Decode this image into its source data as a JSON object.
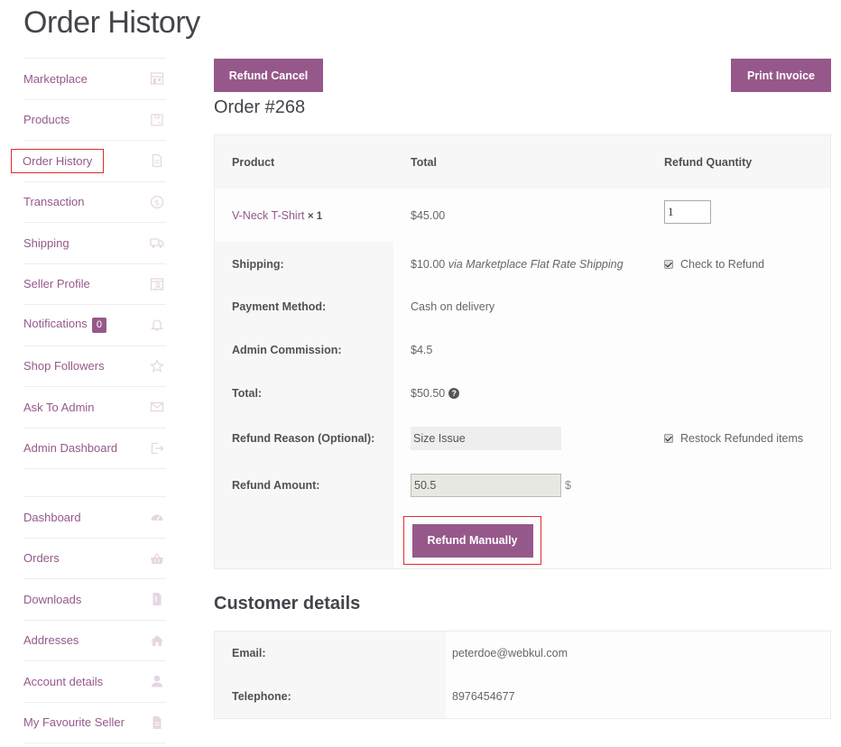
{
  "page": {
    "title": "Order History"
  },
  "sidebar": {
    "primary": [
      {
        "label": "Marketplace",
        "icon": "store-icon"
      },
      {
        "label": "Products",
        "icon": "box-icon"
      },
      {
        "label": "Order History",
        "icon": "document-icon",
        "active": true
      },
      {
        "label": "Transaction",
        "icon": "dollar-circle-icon"
      },
      {
        "label": "Shipping",
        "icon": "truck-icon"
      },
      {
        "label": "Seller Profile",
        "icon": "profile-card-icon"
      },
      {
        "label": "Notifications",
        "icon": "bell-icon",
        "badge": "0"
      },
      {
        "label": "Shop Followers",
        "icon": "star-icon"
      },
      {
        "label": "Ask To Admin",
        "icon": "envelope-icon"
      },
      {
        "label": "Admin Dashboard",
        "icon": "sign-out-icon"
      }
    ],
    "secondary": [
      {
        "label": "Dashboard",
        "icon": "speedometer-icon"
      },
      {
        "label": "Orders",
        "icon": "basket-icon"
      },
      {
        "label": "Downloads",
        "icon": "file-download-icon"
      },
      {
        "label": "Addresses",
        "icon": "home-icon"
      },
      {
        "label": "Account details",
        "icon": "user-icon"
      },
      {
        "label": "My Favourite Seller",
        "icon": "file-icon"
      }
    ]
  },
  "actions": {
    "refund_cancel": "Refund Cancel",
    "print_invoice": "Print Invoice"
  },
  "order": {
    "title": "Order #268",
    "headers": {
      "product": "Product",
      "total": "Total",
      "refund_qty": "Refund Quantity"
    },
    "item": {
      "name": "V-Neck T-Shirt",
      "qty": "× 1",
      "total": "$45.00",
      "refund_qty_value": "1"
    },
    "shipping": {
      "label": "Shipping:",
      "amount": "$10.00",
      "method": "via Marketplace Flat Rate Shipping",
      "checkbox_label": "Check to Refund",
      "checked": true
    },
    "payment_method": {
      "label": "Payment Method:",
      "value": "Cash on delivery"
    },
    "admin_commission": {
      "label": "Admin Commission:",
      "value": "$4.5"
    },
    "total": {
      "label": "Total:",
      "value": "$50.50",
      "help": "?"
    },
    "refund_reason": {
      "label": "Refund Reason (Optional):",
      "value": "Size Issue",
      "restock_label": "Restock Refunded items",
      "restock_checked": true
    },
    "refund_amount": {
      "label": "Refund Amount:",
      "value": "50.5",
      "currency": "$"
    },
    "refund_manually": "Refund Manually"
  },
  "customer": {
    "title": "Customer details",
    "email": {
      "label": "Email:",
      "value": "peterdoe@webkul.com"
    },
    "telephone": {
      "label": "Telephone:",
      "value": "8976454677"
    }
  }
}
